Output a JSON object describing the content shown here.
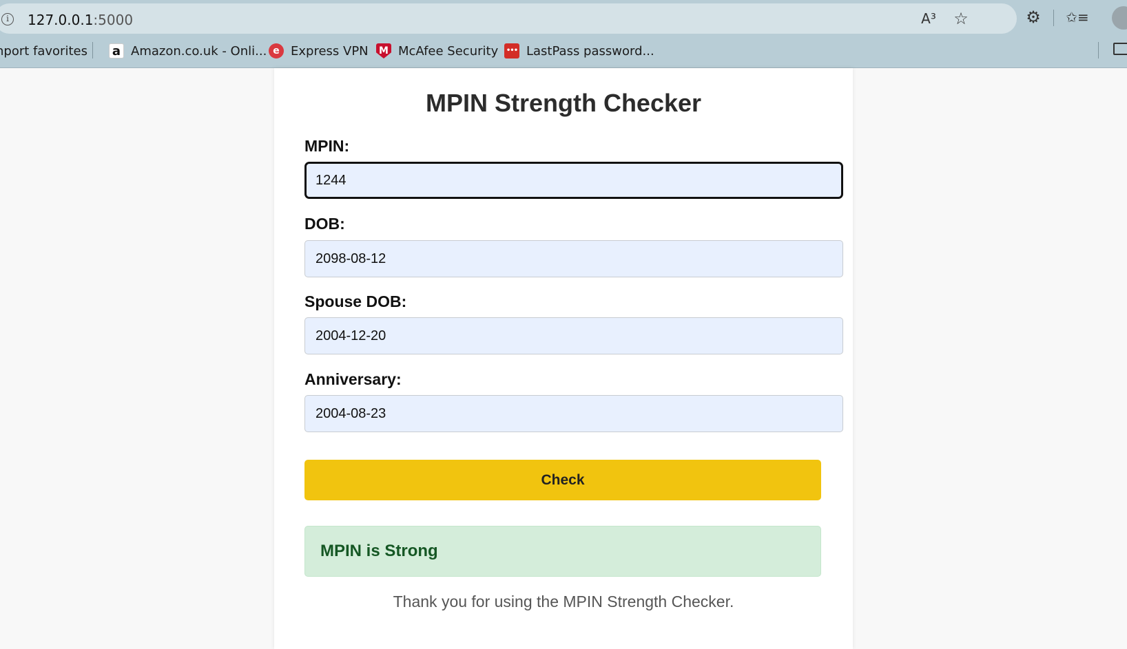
{
  "browser": {
    "url_host": "127.0.0.1",
    "url_port": ":5000",
    "info_glyph": "i",
    "read_aloud_glyph": "A³",
    "favorite_glyph": "☆",
    "extensions_glyph": "⚙",
    "favorites_glyph": "✩≡",
    "bookmarks": [
      {
        "label": "nport favorites",
        "icon": "none"
      },
      {
        "label": "Amazon.co.uk - Onli...",
        "icon": "amazon-icon",
        "glyph": "a"
      },
      {
        "label": "Express VPN",
        "icon": "expressvpn-icon",
        "glyph": "e"
      },
      {
        "label": "McAfee Security",
        "icon": "mcafee-icon",
        "glyph": "M"
      },
      {
        "label": "LastPass password...",
        "icon": "lastpass-icon",
        "glyph": "•••"
      }
    ]
  },
  "page": {
    "title": "MPIN Strength Checker",
    "fields": {
      "mpin": {
        "label": "MPIN:",
        "value": "1244"
      },
      "dob": {
        "label": "DOB:",
        "value": "2098-08-12"
      },
      "spouse_dob": {
        "label": "Spouse DOB:",
        "value": "2004-12-20"
      },
      "anniversary": {
        "label": "Anniversary:",
        "value": "2004-08-23"
      }
    },
    "check_label": "Check",
    "result": "MPIN is Strong",
    "footer": "Thank you for using the MPIN Strength Checker."
  },
  "colors": {
    "button": "#f1c40f",
    "result_bg": "#d4edda",
    "result_text": "#155724",
    "input_bg": "#e8f0fe"
  }
}
